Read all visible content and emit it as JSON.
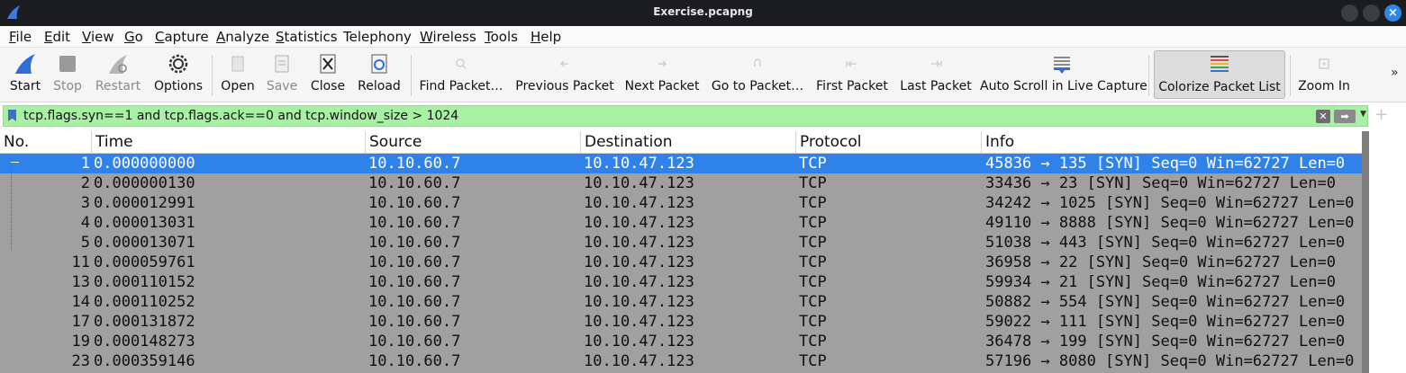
{
  "window": {
    "title": "Exercise.pcapng"
  },
  "menu": [
    {
      "label": "File",
      "u": "F",
      "rest": "ile"
    },
    {
      "label": "Edit",
      "u": "E",
      "rest": "dit"
    },
    {
      "label": "View",
      "u": "V",
      "rest": "iew"
    },
    {
      "label": "Go",
      "u": "G",
      "rest": "o"
    },
    {
      "label": "Capture",
      "u": "C",
      "rest": "apture"
    },
    {
      "label": "Analyze",
      "u": "A",
      "rest": "nalyze"
    },
    {
      "label": "Statistics",
      "u": "S",
      "rest": "tatistics"
    },
    {
      "label": "Telephony",
      "u": "",
      "rest": "Telephony"
    },
    {
      "label": "Wireless",
      "u": "W",
      "rest": "ireless"
    },
    {
      "label": "Tools",
      "u": "T",
      "rest": "ools"
    },
    {
      "label": "Help",
      "u": "H",
      "rest": "elp"
    }
  ],
  "toolbar": {
    "start": "Start",
    "stop": "Stop",
    "restart": "Restart",
    "options": "Options",
    "open": "Open",
    "save": "Save",
    "close": "Close",
    "reload": "Reload",
    "find_packet": "Find Packet…",
    "previous_packet": "Previous Packet",
    "next_packet": "Next Packet",
    "go_to_packet": "Go to Packet…",
    "first_packet": "First Packet",
    "last_packet": "Last Packet",
    "auto_scroll": "Auto Scroll in Live Capture",
    "colorize": "Colorize Packet List",
    "zoom_in": "Zoom In",
    "more": "»"
  },
  "filter": {
    "expression": "tcp.flags.syn==1 and tcp.flags.ack==0 and tcp.window_size > 1024"
  },
  "packet_list": {
    "columns": {
      "no": "No.",
      "time": "Time",
      "source": "Source",
      "destination": "Destination",
      "protocol": "Protocol",
      "info": "Info"
    },
    "rows": [
      {
        "no": "1",
        "time": "0.000000000",
        "source": "10.10.60.7",
        "destination": "10.10.47.123",
        "protocol": "TCP",
        "info": "45836 → 135 [SYN] Seq=0 Win=62727 Len=0",
        "selected": true
      },
      {
        "no": "2",
        "time": "0.000000130",
        "source": "10.10.60.7",
        "destination": "10.10.47.123",
        "protocol": "TCP",
        "info": "33436 → 23 [SYN] Seq=0 Win=62727 Len=0",
        "selected": false
      },
      {
        "no": "3",
        "time": "0.000012991",
        "source": "10.10.60.7",
        "destination": "10.10.47.123",
        "protocol": "TCP",
        "info": "34242 → 1025 [SYN] Seq=0 Win=62727 Len=0",
        "selected": false
      },
      {
        "no": "4",
        "time": "0.000013031",
        "source": "10.10.60.7",
        "destination": "10.10.47.123",
        "protocol": "TCP",
        "info": "49110 → 8888 [SYN] Seq=0 Win=62727 Len=0",
        "selected": false
      },
      {
        "no": "5",
        "time": "0.000013071",
        "source": "10.10.60.7",
        "destination": "10.10.47.123",
        "protocol": "TCP",
        "info": "51038 → 443 [SYN] Seq=0 Win=62727 Len=0",
        "selected": false
      },
      {
        "no": "11",
        "time": "0.000059761",
        "source": "10.10.60.7",
        "destination": "10.10.47.123",
        "protocol": "TCP",
        "info": "36958 → 22 [SYN] Seq=0 Win=62727 Len=0",
        "selected": false
      },
      {
        "no": "13",
        "time": "0.000110152",
        "source": "10.10.60.7",
        "destination": "10.10.47.123",
        "protocol": "TCP",
        "info": "59934 → 21 [SYN] Seq=0 Win=62727 Len=0",
        "selected": false
      },
      {
        "no": "14",
        "time": "0.000110252",
        "source": "10.10.60.7",
        "destination": "10.10.47.123",
        "protocol": "TCP",
        "info": "50882 → 554 [SYN] Seq=0 Win=62727 Len=0",
        "selected": false
      },
      {
        "no": "17",
        "time": "0.000131872",
        "source": "10.10.60.7",
        "destination": "10.10.47.123",
        "protocol": "TCP",
        "info": "59022 → 111 [SYN] Seq=0 Win=62727 Len=0",
        "selected": false
      },
      {
        "no": "19",
        "time": "0.000148273",
        "source": "10.10.60.7",
        "destination": "10.10.47.123",
        "protocol": "TCP",
        "info": "36478 → 199 [SYN] Seq=0 Win=62727 Len=0",
        "selected": false
      },
      {
        "no": "23",
        "time": "0.000359146",
        "source": "10.10.60.7",
        "destination": "10.10.47.123",
        "protocol": "TCP",
        "info": "57196 → 8080 [SYN] Seq=0 Win=62727 Len=0",
        "selected": false
      }
    ]
  },
  "colors": {
    "selected_row": "#2f82ea",
    "row_background": "#a0a0a0",
    "filter_valid": "#a8f0a3",
    "titlebar": "#1b1d21",
    "close_button": "#2f86e8"
  },
  "icons": {
    "app": "shark-fin-icon",
    "start": "shark-fin-icon",
    "stop": "stop-square-icon",
    "restart": "restart-fin-icon",
    "options": "gear-icon",
    "open": "folder-open-icon",
    "save": "save-icon",
    "close": "close-file-icon",
    "reload": "reload-icon",
    "find": "search-icon",
    "previous": "arrow-left-icon",
    "next": "arrow-right-icon",
    "go_to": "go-to-icon",
    "first": "first-icon",
    "last": "last-icon",
    "auto_scroll": "auto-scroll-icon",
    "colorize": "colorize-icon",
    "zoom_in": "zoom-in-icon"
  }
}
